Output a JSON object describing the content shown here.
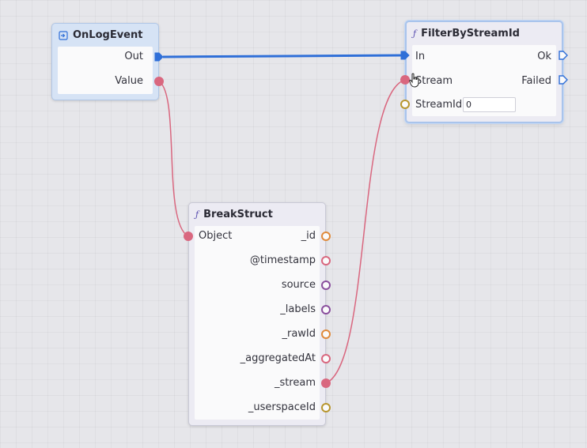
{
  "nodes": {
    "on_log_event": {
      "title": "OnLogEvent",
      "icon": "event-icon",
      "pins": {
        "out": "Out",
        "value": "Value"
      }
    },
    "filter_by_stream_id": {
      "title": "FilterByStreamId",
      "icon": "function-icon",
      "icon_glyph": "ƒ",
      "pins": {
        "in": "In",
        "ok": "Ok",
        "stream": "Stream",
        "failed": "Failed",
        "stream_id": "StreamId"
      },
      "stream_id_value": "0"
    },
    "break_struct": {
      "title": "BreakStruct",
      "icon": "function-icon",
      "icon_glyph": "ƒ",
      "pins": {
        "object": "Object",
        "outputs": [
          "_id",
          "@timestamp",
          "source",
          "_labels",
          "_rawId",
          "_aggregatedAt",
          "_stream",
          "_userspaceId"
        ]
      }
    }
  },
  "colors": {
    "exec_wire": "#2f6fd8",
    "data_wire": "#d9677f",
    "pin_string": "#e08a3c",
    "pin_pink": "#d9677f",
    "pin_purple": "#8a4f9e",
    "pin_gold": "#b8962e"
  }
}
